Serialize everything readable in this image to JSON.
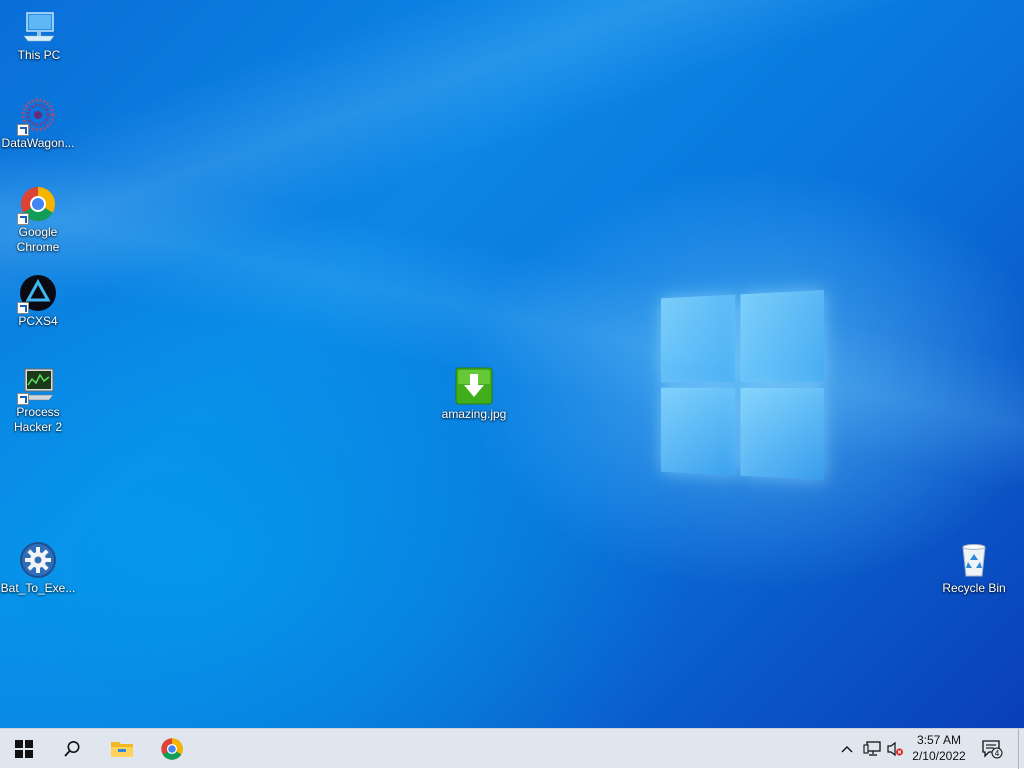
{
  "desktop": {
    "icons": [
      {
        "label": "This PC",
        "icon": "this-pc-icon"
      },
      {
        "label": "DataWagon...",
        "icon": "datawagon-icon"
      },
      {
        "label": "Google Chrome",
        "icon": "chrome-icon"
      },
      {
        "label": "PCXS4",
        "icon": "pcxs4-icon"
      },
      {
        "label": "Process Hacker 2",
        "icon": "process-hacker-icon"
      },
      {
        "label": "Bat_To_Exe...",
        "icon": "gear-icon"
      },
      {
        "label": "amazing.jpg",
        "icon": "download-arrow-icon"
      },
      {
        "label": "Recycle Bin",
        "icon": "recycle-bin-icon"
      }
    ]
  },
  "taskbar": {
    "pinned": [
      {
        "name": "start",
        "icon": "windows-logo-icon"
      },
      {
        "name": "search",
        "icon": "search-icon"
      },
      {
        "name": "file-explorer",
        "icon": "folder-icon"
      },
      {
        "name": "chrome",
        "icon": "chrome-icon"
      }
    ],
    "tray": {
      "time": "3:57 AM",
      "date": "2/10/2022",
      "notification_count": "4"
    }
  },
  "colors": {
    "taskbar_bg": "#dfe6ee",
    "desktop_accent": "#0a74dc"
  }
}
